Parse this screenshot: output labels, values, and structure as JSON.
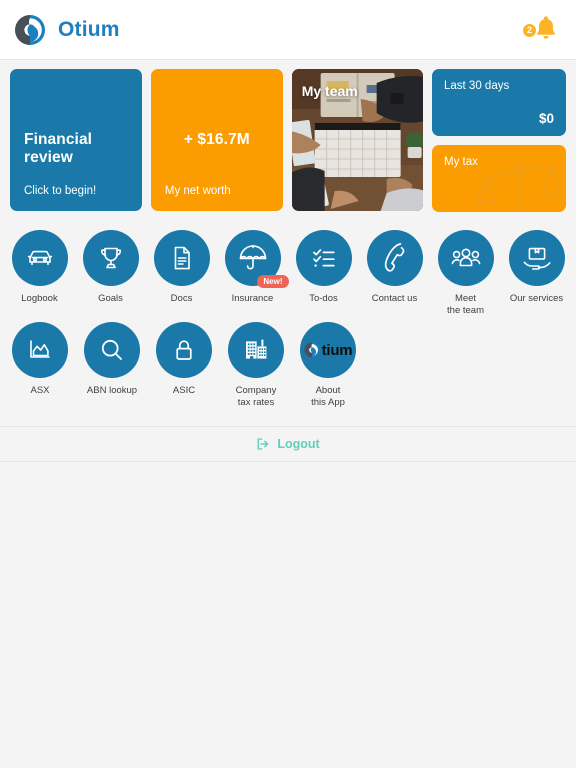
{
  "header": {
    "brand_name": "Otium",
    "logo_icon": "otium-swirl-logo",
    "bell_icon": "notification-bell-icon",
    "notification_count": "2"
  },
  "colors": {
    "blue": "#1a79a8",
    "orange": "#fb9c00",
    "brand_blue": "#1e7fc0",
    "badge_red": "#ef6457",
    "logout_teal": "#5fd0bf",
    "page_bg": "#f4f4f4"
  },
  "cards": [
    {
      "name": "financial-review-card",
      "title": "Financial review",
      "subtitle": "Click to begin!",
      "style": "blue"
    },
    {
      "name": "net-worth-card",
      "title": "+ $16.7M",
      "subtitle": "My net worth",
      "style": "orange"
    },
    {
      "name": "my-team-card",
      "title": "My team",
      "style": "photo"
    },
    {
      "name": "last-30-days-card",
      "title": "Last 30 days",
      "amount": "$0",
      "style": "blue"
    },
    {
      "name": "my-tax-card",
      "title": "My tax",
      "style": "orange",
      "watermark_icon": "scales-of-justice-icon"
    }
  ],
  "icon_grid": {
    "row1": [
      {
        "label": "Logbook",
        "icon": "car-icon"
      },
      {
        "label": "Goals",
        "icon": "trophy-icon"
      },
      {
        "label": "Docs",
        "icon": "document-icon"
      },
      {
        "label": "Insurance",
        "icon": "umbrella-icon",
        "badge": "New!"
      },
      {
        "label": "To-dos",
        "icon": "checklist-icon"
      },
      {
        "label": "Contact us",
        "icon": "phone-icon"
      },
      {
        "label": "Meet\nthe team",
        "icon": "people-group-icon"
      },
      {
        "label": "Our services",
        "icon": "hand-holding-box-icon"
      }
    ],
    "row2": [
      {
        "label": "ASX",
        "icon": "area-chart-icon"
      },
      {
        "label": "ABN lookup",
        "icon": "magnifier-icon"
      },
      {
        "label": "ASIC",
        "icon": "padlock-icon"
      },
      {
        "label": "Company\ntax rates",
        "icon": "buildings-icon"
      },
      {
        "label": "About\nthis App",
        "icon": "otium-logo-icon",
        "mark_text": "tium"
      }
    ]
  },
  "logout": {
    "label": "Logout",
    "icon": "logout-arrow-icon"
  }
}
